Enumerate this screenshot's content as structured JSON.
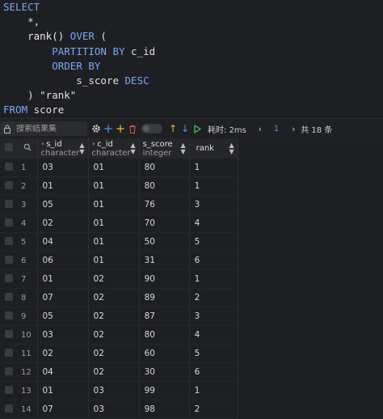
{
  "editor": {
    "lines": [
      [
        {
          "t": "SELECT",
          "c": "kw"
        }
      ],
      [
        {
          "t": "    *,",
          "c": "plain"
        }
      ],
      [
        {
          "t": "    rank() ",
          "c": "fn"
        },
        {
          "t": "OVER",
          "c": "kw"
        },
        {
          "t": " (",
          "c": "plain"
        }
      ],
      [
        {
          "t": "        ",
          "c": "plain"
        },
        {
          "t": "PARTITION BY",
          "c": "kw"
        },
        {
          "t": " c_id",
          "c": "plain"
        }
      ],
      [
        {
          "t": "        ",
          "c": "plain"
        },
        {
          "t": "ORDER BY",
          "c": "kw"
        }
      ],
      [
        {
          "t": "            s_score ",
          "c": "plain"
        },
        {
          "t": "DESC",
          "c": "kw"
        }
      ],
      [
        {
          "t": "    ) \"rank\"",
          "c": "plain"
        }
      ],
      [
        {
          "t": "FROM",
          "c": "kw"
        },
        {
          "t": " score",
          "c": "plain"
        }
      ]
    ]
  },
  "toolbar": {
    "search_placeholder": "搜索结果集",
    "duration_label": "耗时: 2ms",
    "page_number": "1",
    "total_label": "共 18 条",
    "icons": [
      "lock-icon",
      "settings-icon",
      "add-icon",
      "add-row-icon",
      "delete-icon",
      "toggle",
      "arrow-up-icon",
      "arrow-down-icon",
      "run-icon",
      "chevron-left-icon",
      "chevron-right-icon"
    ],
    "colors": {
      "add": "#4f8ef7",
      "add_row": "#e8b93a",
      "delete": "#e0524f",
      "up": "#e8b93a",
      "down": "#4f8ef7",
      "run": "#4fc26a"
    }
  },
  "grid": {
    "columns": [
      {
        "name": "s_id",
        "type": "character",
        "required": true
      },
      {
        "name": "c_id",
        "type": "character",
        "required": true
      },
      {
        "name": "s_score",
        "type": "integer",
        "required": false
      },
      {
        "name": "rank",
        "type": "",
        "required": false
      }
    ],
    "rows": [
      [
        "1",
        "03",
        "01",
        "80",
        "1"
      ],
      [
        "2",
        "01",
        "01",
        "80",
        "1"
      ],
      [
        "3",
        "05",
        "01",
        "76",
        "3"
      ],
      [
        "4",
        "02",
        "01",
        "70",
        "4"
      ],
      [
        "5",
        "04",
        "01",
        "50",
        "5"
      ],
      [
        "6",
        "06",
        "01",
        "31",
        "6"
      ],
      [
        "7",
        "01",
        "02",
        "90",
        "1"
      ],
      [
        "8",
        "07",
        "02",
        "89",
        "2"
      ],
      [
        "9",
        "05",
        "02",
        "87",
        "3"
      ],
      [
        "10",
        "03",
        "02",
        "80",
        "4"
      ],
      [
        "11",
        "02",
        "02",
        "60",
        "5"
      ],
      [
        "12",
        "04",
        "02",
        "30",
        "6"
      ],
      [
        "13",
        "01",
        "03",
        "99",
        "1"
      ],
      [
        "14",
        "07",
        "03",
        "98",
        "2"
      ]
    ]
  }
}
